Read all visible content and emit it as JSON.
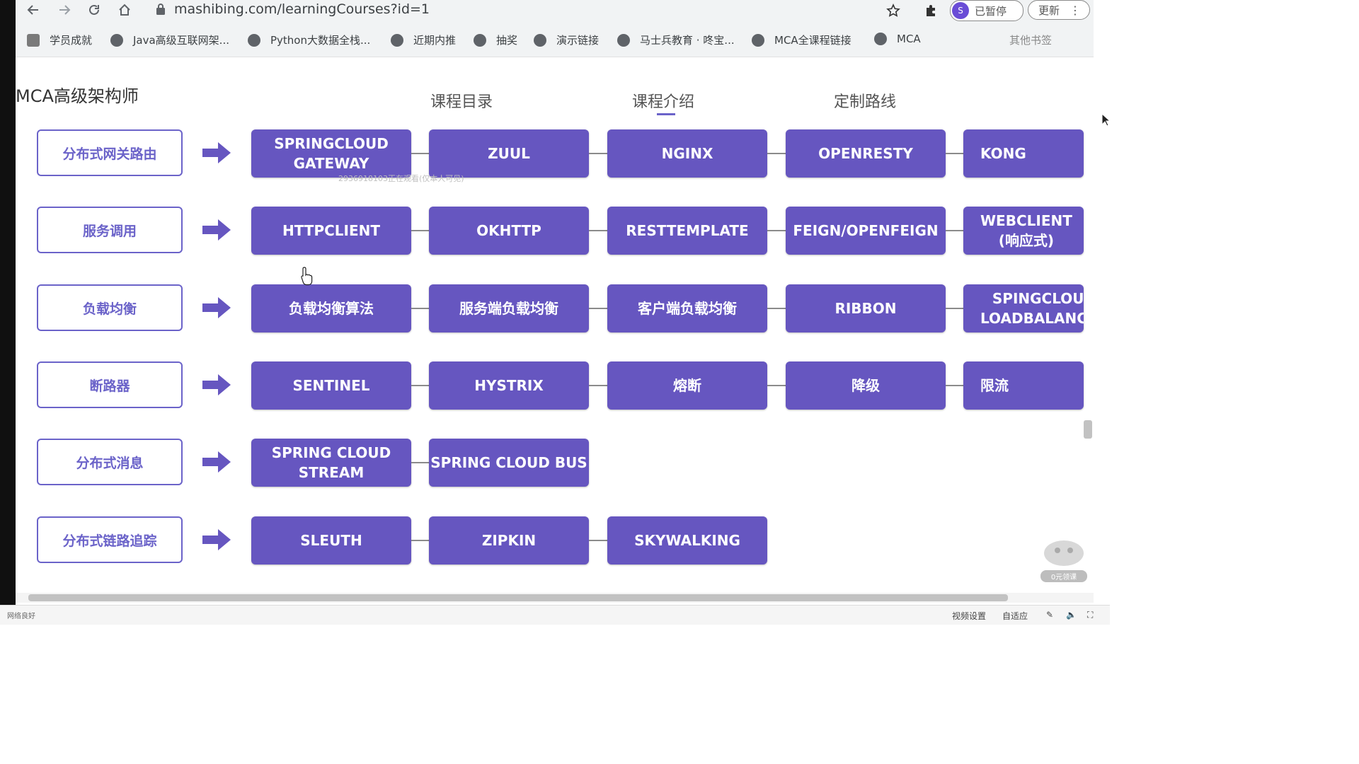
{
  "browser": {
    "url": "mashibing.com/learningCourses?id=1",
    "profile_initial": "S",
    "paused_label": "已暂停",
    "update_label": "更新"
  },
  "bookmarks": [
    {
      "label": "学员成就"
    },
    {
      "label": "Java高级互联网架..."
    },
    {
      "label": "Python大数据全栈..."
    },
    {
      "label": "近期内推"
    },
    {
      "label": "抽奖"
    },
    {
      "label": "演示链接"
    },
    {
      "label": "马士兵教育 · 咚宝..."
    },
    {
      "label": "MCA全课程链接"
    },
    {
      "label": "MCA"
    },
    {
      "label": "其他书签"
    }
  ],
  "page": {
    "title": "MCA高级架构师",
    "tabs": [
      {
        "label": "课程目录"
      },
      {
        "label": "课程介绍"
      },
      {
        "label": "定制路线"
      }
    ],
    "viewer_watermark": "2936918103正在观看(仅本人可见)"
  },
  "rows": [
    {
      "category": "分布式网关路由",
      "items": [
        "SPRINGCLOUD\nGATEWAY",
        "ZUUL",
        "NGINX",
        "OPENRESTY",
        "KONG"
      ]
    },
    {
      "category": "服务调用",
      "items": [
        "HTTPCLIENT",
        "OKHTTP",
        "RESTTEMPLATE",
        "FEIGN/OPENFEIGN",
        "WEBCLIENT\n(响应式)"
      ]
    },
    {
      "category": "负载均衡",
      "items": [
        "负载均衡算法",
        "服务端负载均衡",
        "客户端负载均衡",
        "RIBBON",
        "SPINGCLOUD\nLOADBALANCER"
      ]
    },
    {
      "category": "断路器",
      "items": [
        "SENTINEL",
        "HYSTRIX",
        "熔断",
        "降级",
        "限流"
      ]
    },
    {
      "category": "分布式消息",
      "items": [
        "SPRING CLOUD\nSTREAM",
        "SPRING CLOUD BUS"
      ]
    },
    {
      "category": "分布式链路追踪",
      "items": [
        "SLEUTH",
        "ZIPKIN",
        "SKYWALKING"
      ]
    }
  ],
  "player": {
    "network": "网络良好",
    "video_settings": "视频设置",
    "adaptive": "自适应",
    "mascot_label": "0元领课"
  },
  "colors": {
    "accent": "#6656c0",
    "category_border": "#6b63c9"
  },
  "icons": [
    "back-icon",
    "forward-icon",
    "reload-icon",
    "home-icon",
    "lock-icon",
    "star-icon",
    "extension-icon",
    "menu-dots-icon",
    "arrow-right-icon",
    "hand-cursor-icon"
  ]
}
